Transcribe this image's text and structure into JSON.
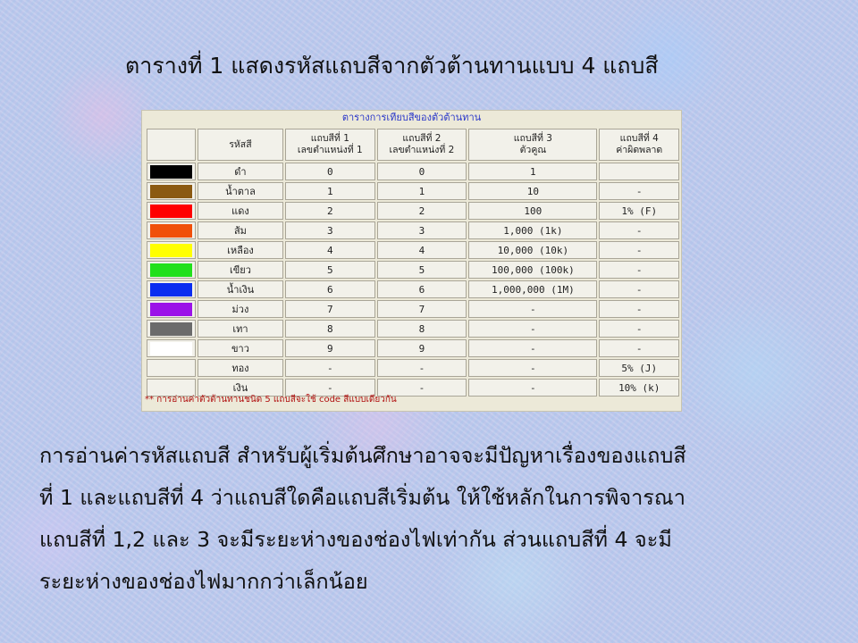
{
  "title": "ตารางที่ 1 แสดงรหัสแถบสีจากตัวต้านทานแบบ 4 แถบสี",
  "table": {
    "caption": "ตารางการเทียบสีของตัวต้านทาน",
    "headers": {
      "color_name": "รหัสสี",
      "band1_line1": "แถบสีที่ 1",
      "band1_line2": "เลขตำแหน่งที่ 1",
      "band2_line1": "แถบสีที่ 2",
      "band2_line2": "เลขตำแหน่งที่ 2",
      "band3_line1": "แถบสีที่ 3",
      "band3_line2": "ตัวคูณ",
      "band4_line1": "แถบสีที่ 4",
      "band4_line2": "ค่าผิดพลาด"
    },
    "rows": [
      {
        "swatch": "#000000",
        "name": "ดำ",
        "band1": "0",
        "band2": "0",
        "multiplier": "1",
        "tolerance": ""
      },
      {
        "swatch": "#8b5a12",
        "name": "น้ำตาล",
        "band1": "1",
        "band2": "1",
        "multiplier": "10",
        "tolerance": "-"
      },
      {
        "swatch": "#ff0000",
        "name": "แดง",
        "band1": "2",
        "band2": "2",
        "multiplier": "100",
        "tolerance": "1% (F)"
      },
      {
        "swatch": "#f0500a",
        "name": "ส้ม",
        "band1": "3",
        "band2": "3",
        "multiplier": "1,000 (1k)",
        "tolerance": "-"
      },
      {
        "swatch": "#ffff00",
        "name": "เหลือง",
        "band1": "4",
        "band2": "4",
        "multiplier": "10,000 (10k)",
        "tolerance": "-"
      },
      {
        "swatch": "#22e01c",
        "name": "เขียว",
        "band1": "5",
        "band2": "5",
        "multiplier": "100,000 (100k)",
        "tolerance": "-"
      },
      {
        "swatch": "#0a2cf0",
        "name": "น้ำเงิน",
        "band1": "6",
        "band2": "6",
        "multiplier": "1,000,000 (1M)",
        "tolerance": "-"
      },
      {
        "swatch": "#9b12e8",
        "name": "ม่วง",
        "band1": "7",
        "band2": "7",
        "multiplier": "-",
        "tolerance": "-"
      },
      {
        "swatch": "#6b6b6b",
        "name": "เทา",
        "band1": "8",
        "band2": "8",
        "multiplier": "-",
        "tolerance": "-"
      },
      {
        "swatch": "#ffffff",
        "name": "ขาว",
        "band1": "9",
        "band2": "9",
        "multiplier": "-",
        "tolerance": "-"
      },
      {
        "swatch": "",
        "name": "ทอง",
        "band1": "-",
        "band2": "-",
        "multiplier": "-",
        "tolerance": "5% (J)"
      },
      {
        "swatch": "",
        "name": "เงิน",
        "band1": "-",
        "band2": "-",
        "multiplier": "-",
        "tolerance": "10% (k)"
      }
    ],
    "footnote": "** การอ่านค่าตัวต้านทานชนิด 5 แถบสีจะใช้ code สีแบบเดียวกัน"
  },
  "paragraph": {
    "lines": [
      "  การอ่านค่ารหัสแถบสี สำหรับผู้เริ่มต้นศึกษาอาจจะมีปัญหาเรื่องของแถบสี",
      "ที่ 1 และแถบสีที่ 4 ว่าแถบสีใดคือแถบสีเริ่มต้น ให้ใช้หลักในการพิจารณา",
      "แถบสีที่ 1,2 และ 3 จะมีระยะห่างของช่องไฟเท่ากัน ส่วนแถบสีที่ 4 จะมี",
      "ระยะห่างของช่องไฟมากกว่าเล็กน้อย"
    ]
  }
}
